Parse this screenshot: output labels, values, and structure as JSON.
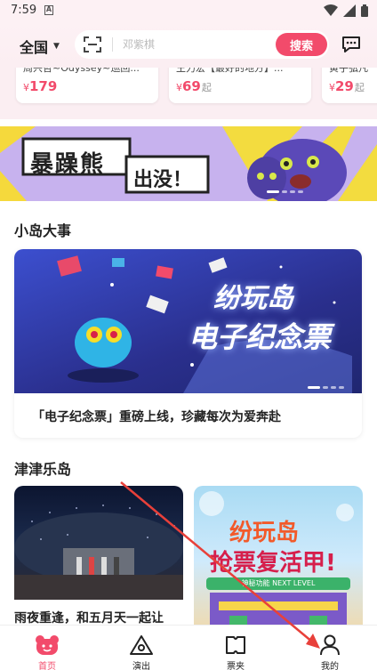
{
  "status_bar": {
    "time": "7:59",
    "notif_letter": "A"
  },
  "header": {
    "city": "全国",
    "search_placeholder": "邓紫棋",
    "search_button": "搜索"
  },
  "product_cards": [
    {
      "title": "周兴哲~Odyssey~巡回...",
      "currency": "¥",
      "price": "179",
      "suffix": ""
    },
    {
      "title": "王力宏【最好的地方】...",
      "currency": "¥",
      "price": "69",
      "suffix": "起"
    },
    {
      "title": "黄子弘凡",
      "currency": "¥",
      "price": "29",
      "suffix": "起"
    }
  ],
  "banner": {
    "text_main": "暴躁熊",
    "text_sub": "出没！"
  },
  "section1": {
    "title": "小岛大事",
    "feature_image_text1": "纷玩岛",
    "feature_image_text2": "电子纪念票",
    "feature_caption": "「电子纪念票」重磅上线，珍藏每次为爱奔赴"
  },
  "section2": {
    "title": "津津乐岛",
    "left_card_caption": "雨夜重逢，和五月天一起让",
    "right_card_text1": "纷玩岛",
    "right_card_text2": "抢票复活甲!",
    "right_card_strip": "神秘功能 NEXT LEVEL"
  },
  "bottom_nav": [
    {
      "label": "首页",
      "icon": "bear-home-icon",
      "active": true
    },
    {
      "label": "演出",
      "icon": "triangle-show-icon",
      "active": false
    },
    {
      "label": "票夹",
      "icon": "ticket-folder-icon",
      "active": false
    },
    {
      "label": "我的",
      "icon": "person-icon",
      "active": false
    }
  ],
  "colors": {
    "accent": "#f24b6b",
    "header_bg": "#fdf1f4",
    "annotation": "#e8403a"
  }
}
